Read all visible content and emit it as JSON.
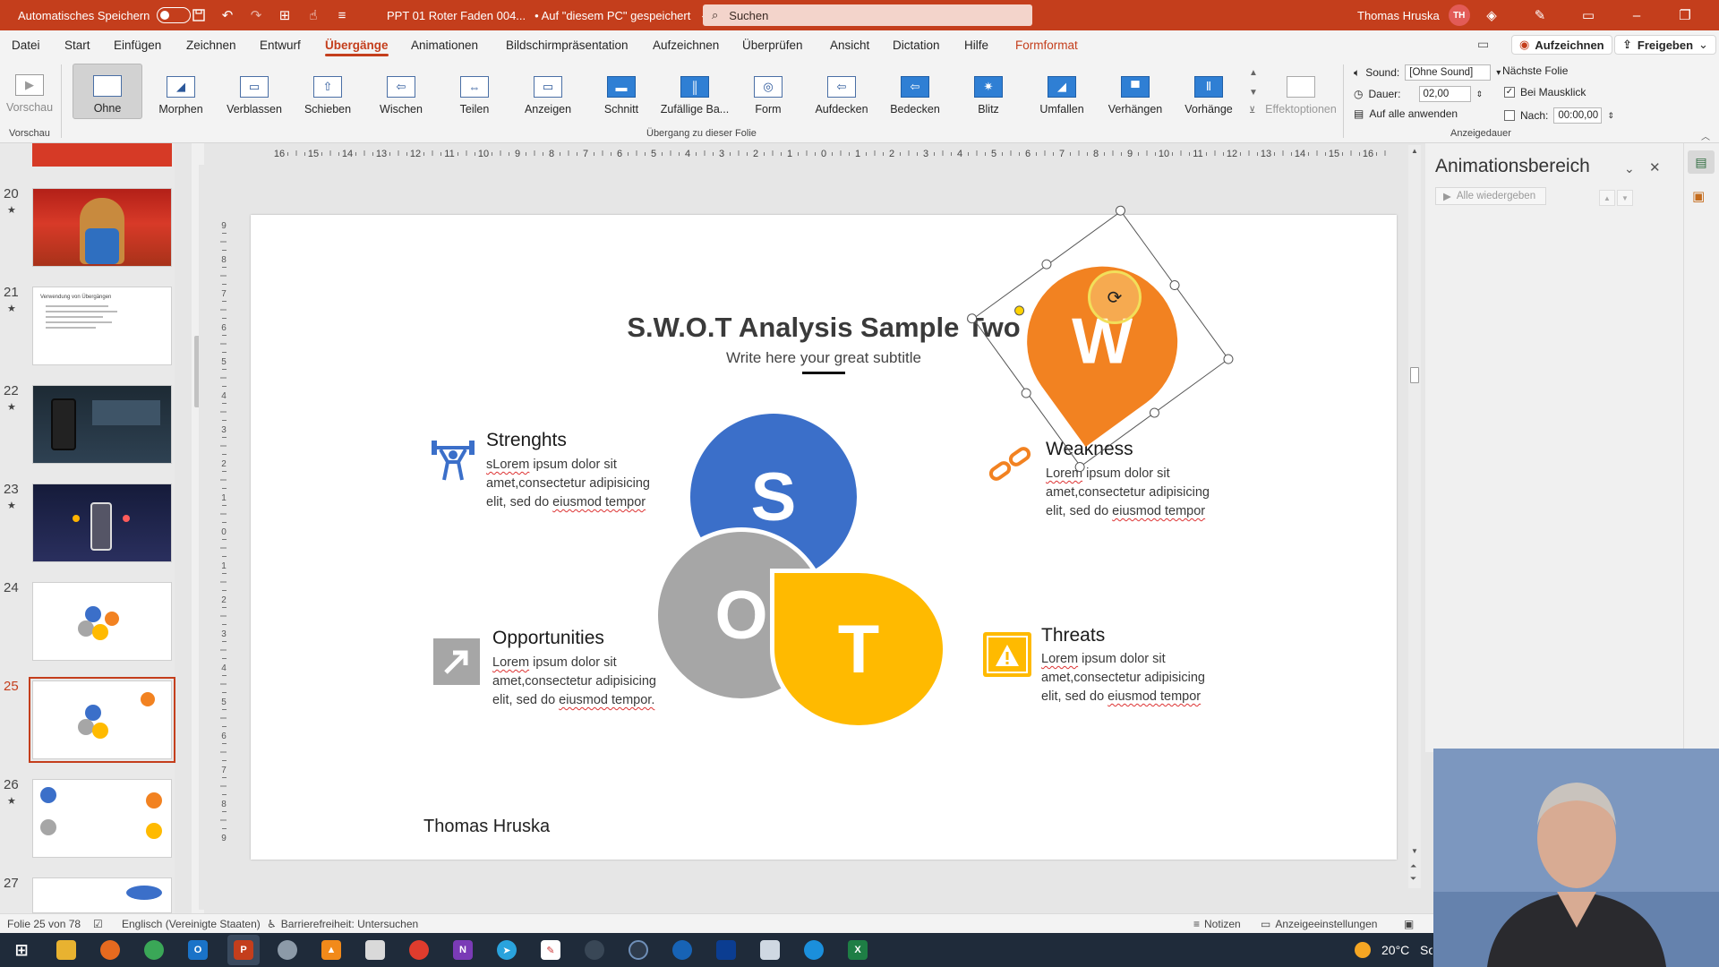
{
  "titlebar": {
    "autosave_label": "Automatisches Speichern",
    "doc_title": "PPT 01 Roter Faden 004...",
    "save_status": "• Auf \"diesem PC\" gespeichert",
    "search_placeholder": "Suchen",
    "user_name": "Thomas Hruska",
    "user_initials": "TH"
  },
  "tabs": {
    "datei": "Datei",
    "start": "Start",
    "einfuegen": "Einfügen",
    "zeichnen": "Zeichnen",
    "entwurf": "Entwurf",
    "uebergaenge": "Übergänge",
    "animationen": "Animationen",
    "bildschirm": "Bildschirmpräsentation",
    "aufzeichnen": "Aufzeichnen",
    "ueberpruefen": "Überprüfen",
    "ansicht": "Ansicht",
    "dictation": "Dictation",
    "hilfe": "Hilfe",
    "formformat": "Formformat",
    "record_button": "Aufzeichnen",
    "share_button": "Freigeben"
  },
  "ribbon": {
    "preview_label": "Vorschau",
    "preview_group": "Vorschau",
    "transitions_group": "Übergang zu dieser Folie",
    "timing_group": "Anzeigedauer",
    "effect_options": "Effektoptionen",
    "transitions": [
      {
        "label": "Ohne",
        "glyph": "",
        "style": "plain"
      },
      {
        "label": "Morphen",
        "glyph": "◢",
        "style": "plain"
      },
      {
        "label": "Verblassen",
        "glyph": "▭",
        "style": "plain"
      },
      {
        "label": "Schieben",
        "glyph": "⇧",
        "style": "plain"
      },
      {
        "label": "Wischen",
        "glyph": "⇦",
        "style": "plain"
      },
      {
        "label": "Teilen",
        "glyph": "⇔",
        "style": "plain"
      },
      {
        "label": "Anzeigen",
        "glyph": "▭",
        "style": "plain"
      },
      {
        "label": "Schnitt",
        "glyph": "▬",
        "style": "filled"
      },
      {
        "label": "Zufällige Ba...",
        "glyph": "║",
        "style": "filled"
      },
      {
        "label": "Form",
        "glyph": "◎",
        "style": "plain"
      },
      {
        "label": "Aufdecken",
        "glyph": "⇦",
        "style": "plain"
      },
      {
        "label": "Bedecken",
        "glyph": "⇦",
        "style": "filled"
      },
      {
        "label": "Blitz",
        "glyph": "✷",
        "style": "filled"
      },
      {
        "label": "Umfallen",
        "glyph": "◢",
        "style": "filled"
      },
      {
        "label": "Verhängen",
        "glyph": "▀",
        "style": "filled"
      },
      {
        "label": "Vorhänge",
        "glyph": "Ⅱ",
        "style": "filled"
      }
    ],
    "sound_label": "Sound:",
    "sound_value": "[Ohne Sound]",
    "duration_label": "Dauer:",
    "duration_value": "02,00",
    "apply_all": "Auf alle anwenden",
    "next_slide_label": "Nächste Folie",
    "on_click_label": "Bei Mausklick",
    "after_label": "Nach:",
    "after_value": "00:00,00"
  },
  "slides": [
    {
      "num": "20"
    },
    {
      "num": "21"
    },
    {
      "num": "22"
    },
    {
      "num": "23"
    },
    {
      "num": "24"
    },
    {
      "num": "25"
    },
    {
      "num": "26"
    },
    {
      "num": "27"
    }
  ],
  "slide_thumb_21_title": "Verwendung von Übergängen",
  "slide": {
    "title": "S.W.O.T Analysis Sample Two",
    "subtitle": "Write here your great subtitle",
    "s_letter": "S",
    "w_letter": "W",
    "o_letter": "O",
    "t_letter": "T",
    "strengths_title": "Strenghts",
    "strengths_body_1": "sLorem",
    "strengths_body_2": " ipsum dolor sit amet,consectetur adipisicing elit, sed do ",
    "strengths_body_3": "eiusmod tempor",
    "weakness_title": "Weakness",
    "weakness_body_1": "Lorem",
    "weakness_body_2": " ipsum dolor sit amet,consectetur adipisicing elit, sed do ",
    "weakness_body_3": "eiusmod tempor",
    "opportunities_title": "Opportunities",
    "opportunities_body_1": "Lorem",
    "opportunities_body_2": " ipsum dolor sit amet,consectetur adipisicing elit, sed do ",
    "opportunities_body_3": "eiusmod tempor.",
    "threats_title": "Threats",
    "threats_body_1": "Lorem",
    "threats_body_2": " ipsum dolor sit amet,consectetur adipisicing elit, sed do ",
    "threats_body_3": "eiusmod tempor",
    "author": "Thomas Hruska"
  },
  "colors": {
    "s_blue": "#3b6fc9",
    "w_orange": "#f28221",
    "o_gray": "#a6a6a6",
    "t_yellow": "#ffba00",
    "accent": "#c43e1c"
  },
  "anim_pane": {
    "title": "Animationsbereich",
    "play_all": "Alle wiedergeben"
  },
  "status": {
    "slide_count": "Folie 25 von 78",
    "language": "Englisch (Vereinigte Staaten)",
    "accessibility": "Barrierefreiheit: Untersuchen",
    "notes": "Notizen",
    "display_settings": "Anzeigeeinstellungen"
  },
  "taskbar": {
    "temperature": "20°C",
    "weather_text": "Sor"
  },
  "icons": {
    "strengths": "weightlifter-icon",
    "weakness": "broken-chain-icon",
    "opportunities": "arrow-up-right-icon",
    "threats": "warning-icon"
  }
}
